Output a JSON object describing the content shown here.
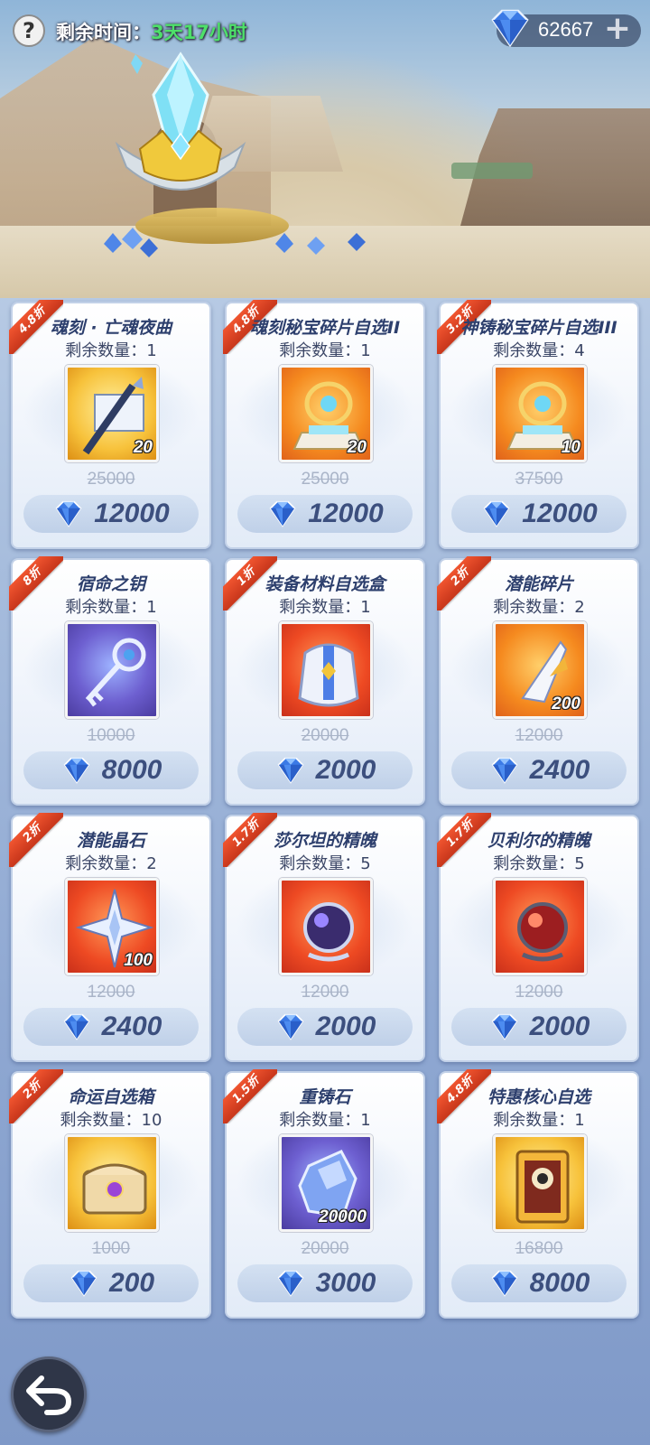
{
  "topbar": {
    "help_label": "?",
    "timer_label": "剩余时间：",
    "timer_value": "3天17小时",
    "currency": "62667",
    "plus_label": "+"
  },
  "colors": {
    "timer_value": "#4ee06a",
    "discount_ribbon": "#e0451f",
    "price_text": "#3c4f7e"
  },
  "items": [
    {
      "discount": "4.8折",
      "name": "魂刻 · 亡魂夜曲",
      "stock": "剩余数量：1",
      "icon": "scroll-scepter-icon",
      "count": "20",
      "old_price": "25000",
      "price": "12000"
    },
    {
      "discount": "4.8折",
      "name": "魂刻秘宝碎片自选II",
      "stock": "剩余数量：1",
      "icon": "relic-pedestal-icon",
      "count": "20",
      "old_price": "25000",
      "price": "12000"
    },
    {
      "discount": "3.2折",
      "name": "神铸秘宝碎片自选III",
      "stock": "剩余数量：4",
      "icon": "relic-pedestal-icon",
      "count": "10",
      "old_price": "37500",
      "price": "12000"
    },
    {
      "discount": "8折",
      "name": "宿命之钥",
      "stock": "剩余数量：1",
      "icon": "key-icon",
      "count": "",
      "old_price": "10000",
      "price": "8000"
    },
    {
      "discount": "1折",
      "name": "装备材料自选盒",
      "stock": "剩余数量：1",
      "icon": "armor-icon",
      "count": "",
      "old_price": "20000",
      "price": "2000"
    },
    {
      "discount": "2折",
      "name": "潜能碎片",
      "stock": "剩余数量：2",
      "icon": "shard-icon",
      "count": "200",
      "old_price": "12000",
      "price": "2400"
    },
    {
      "discount": "2折",
      "name": "潜能晶石",
      "stock": "剩余数量：2",
      "icon": "star-crystal-icon",
      "count": "100",
      "old_price": "12000",
      "price": "2400"
    },
    {
      "discount": "1.7折",
      "name": "莎尔坦的精魄",
      "stock": "剩余数量：5",
      "icon": "spirit-orb-purple-icon",
      "count": "",
      "old_price": "12000",
      "price": "2000"
    },
    {
      "discount": "1.7折",
      "name": "贝利尔的精魄",
      "stock": "剩余数量：5",
      "icon": "spirit-orb-red-icon",
      "count": "",
      "old_price": "12000",
      "price": "2000"
    },
    {
      "discount": "2折",
      "name": "命运自选箱",
      "stock": "剩余数量：10",
      "icon": "treasure-chest-icon",
      "count": "",
      "old_price": "1000",
      "price": "200"
    },
    {
      "discount": "1.5折",
      "name": "重铸石",
      "stock": "剩余数量：1",
      "icon": "reforge-stone-icon",
      "count": "20000",
      "old_price": "20000",
      "price": "3000"
    },
    {
      "discount": "4.8折",
      "name": "特惠核心自选",
      "stock": "剩余数量：1",
      "icon": "core-card-icon",
      "count": "",
      "old_price": "16800",
      "price": "8000"
    }
  ]
}
